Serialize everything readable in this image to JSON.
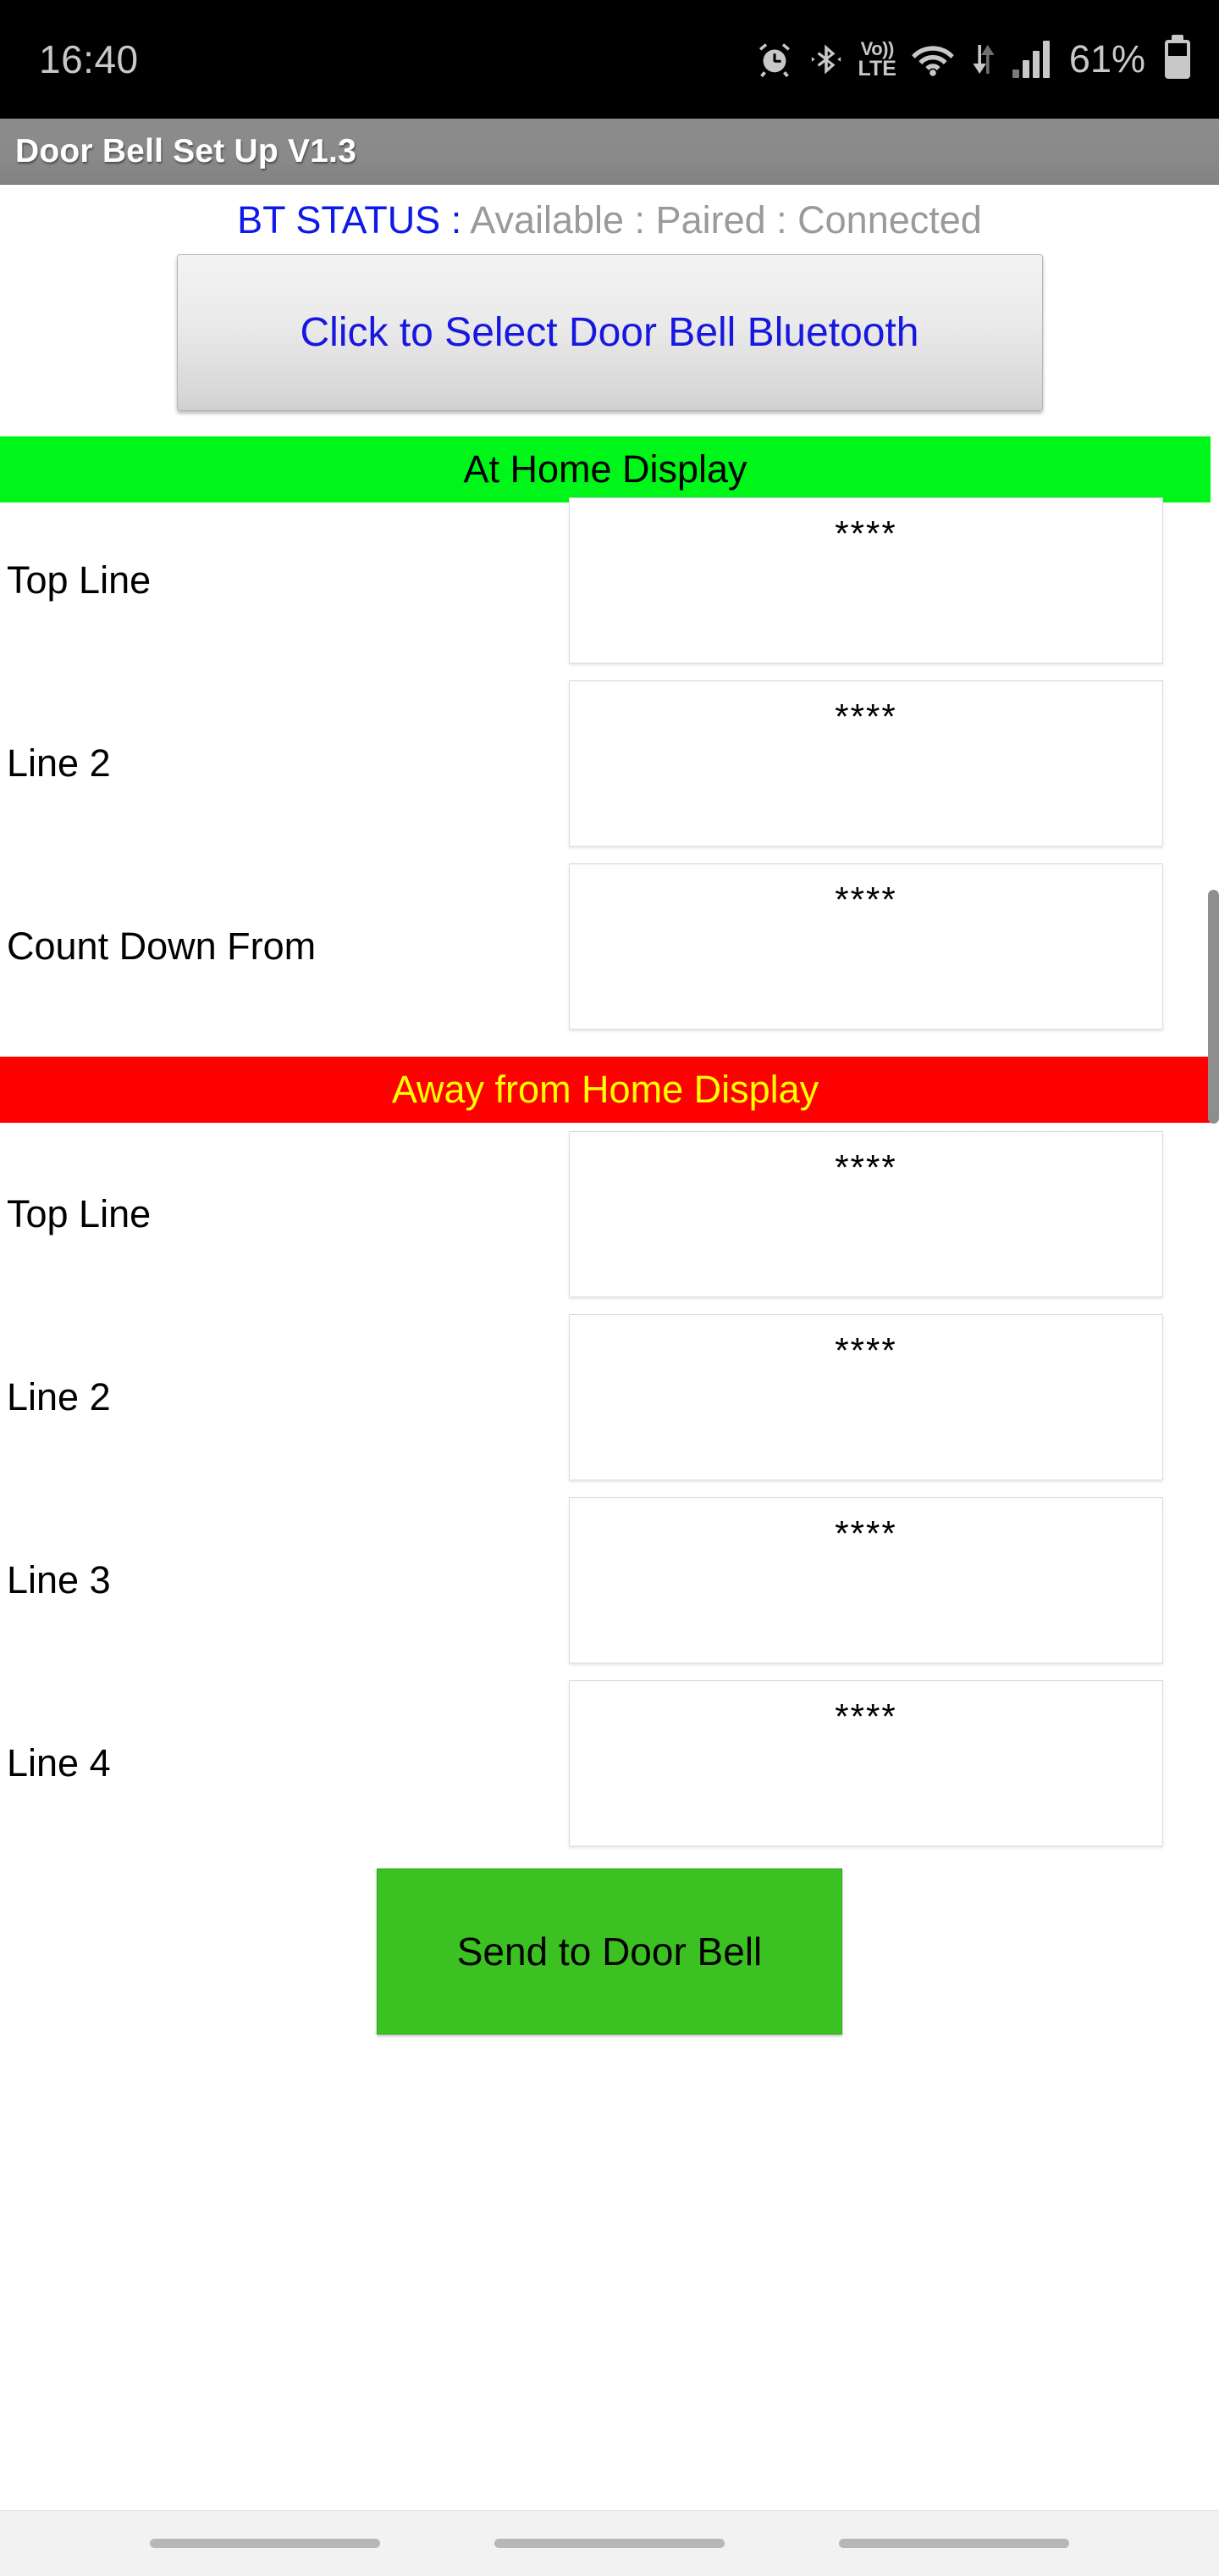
{
  "status_bar": {
    "time": "16:40",
    "battery_percent": "61%",
    "battery_level": 61,
    "volte_top": "Vo))",
    "volte_bottom": "LTE",
    "icons": [
      "alarm-icon",
      "bluetooth-icon",
      "volte-icon",
      "wifi-icon",
      "signal-icon",
      "battery-icon"
    ]
  },
  "title_bar": {
    "title": "Door Bell Set Up V1.3"
  },
  "bt_status": {
    "label": "BT STATUS :",
    "value": "Available : Paired : Connected",
    "label_color": "#0d1ae8",
    "value_color": "#9a9a9a"
  },
  "select_button": {
    "label": "Click to Select Door Bell Bluetooth",
    "text_color": "#1717e0"
  },
  "sections": [
    {
      "banner": "At Home Display",
      "banner_bg": "#00f618",
      "banner_fg": "#000000",
      "fields": [
        {
          "label": "Top Line",
          "value": "****"
        },
        {
          "label": "Line 2",
          "value": "****"
        },
        {
          "label": "Count Down From",
          "value": "****"
        }
      ]
    },
    {
      "banner": "Away from Home Display",
      "banner_bg": "#fe0000",
      "banner_fg": "#ffff00",
      "fields": [
        {
          "label": "Top Line",
          "value": "****"
        },
        {
          "label": "Line 2",
          "value": "****"
        },
        {
          "label": "Line 3",
          "value": "****"
        },
        {
          "label": "Line 4",
          "value": "****"
        }
      ]
    }
  ],
  "send_button": {
    "label": "Send to Door Bell",
    "bg": "#3cc122"
  }
}
